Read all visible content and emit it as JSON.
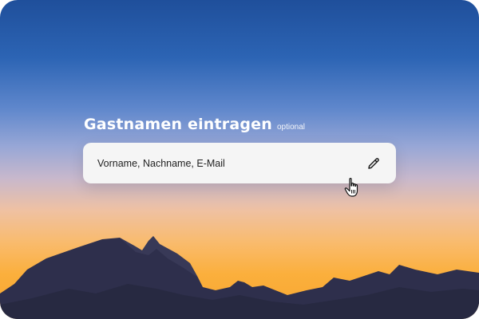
{
  "background": {
    "scene": "sunset-mountains",
    "sky_top_color": "#1f4f9b",
    "sky_bottom_color": "#fbaf3c",
    "mountain_color": "#2e2f4c"
  },
  "field": {
    "label": "Gastnamen eintragen",
    "hint": "optional",
    "placeholder": "Vorname, Nachname, E-Mail",
    "value": "",
    "action_icon": "pencil-icon"
  },
  "pointer": {
    "icon": "hand-pointer-icon"
  }
}
